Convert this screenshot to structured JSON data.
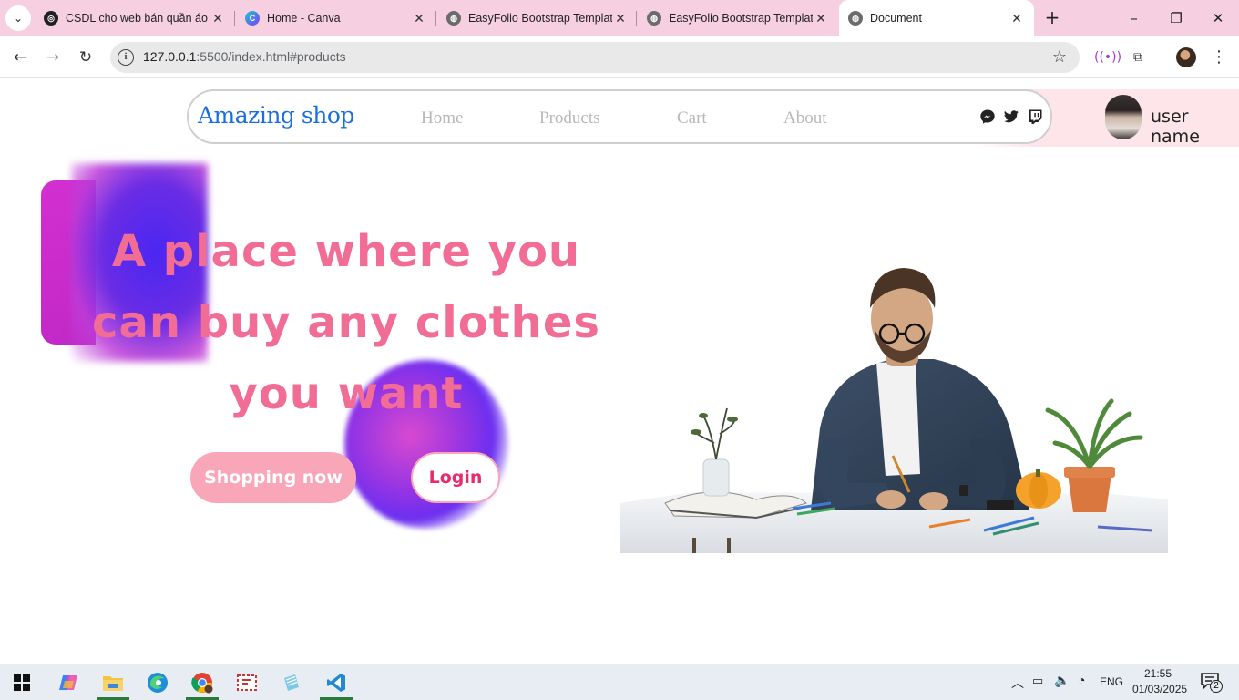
{
  "browser": {
    "tabs": [
      {
        "title": "CSDL cho web bán quần áo",
        "icon": "chatgpt-icon"
      },
      {
        "title": "Home - Canva",
        "icon": "canva-icon"
      },
      {
        "title": "EasyFolio Bootstrap Templat",
        "icon": "globe-icon"
      },
      {
        "title": "EasyFolio Bootstrap Templat",
        "icon": "globe-icon"
      },
      {
        "title": "Document",
        "icon": "globe-icon",
        "active": true
      }
    ],
    "url_host": "127.0.0.1",
    "url_rest": ":5500/index.html#products"
  },
  "site": {
    "brand": "Amazing shop",
    "nav": [
      "Home",
      "Products",
      "Cart",
      "About"
    ],
    "social_icons": [
      "messenger-icon",
      "twitter-icon",
      "twitch-icon"
    ],
    "user_name": "user name",
    "hero_title": "A place where you can buy any clothes you want",
    "shop_button": "Shopping now",
    "login_button": "Login",
    "colors": {
      "brand": "#1a6fe0",
      "hero_text": "#f26d96",
      "shop_button": "#f9a6b8",
      "login_text": "#ea2a6d",
      "deco_purple": "#4a27f2"
    }
  },
  "taskbar": {
    "apps": [
      "copilot-icon",
      "file-explorer-icon",
      "edge-icon",
      "chrome-icon",
      "snipping-tool-icon",
      "notepad-icon",
      "vscode-icon"
    ],
    "language": "ENG",
    "time": "21:55",
    "date": "01/03/2025",
    "notification_count": "2"
  }
}
